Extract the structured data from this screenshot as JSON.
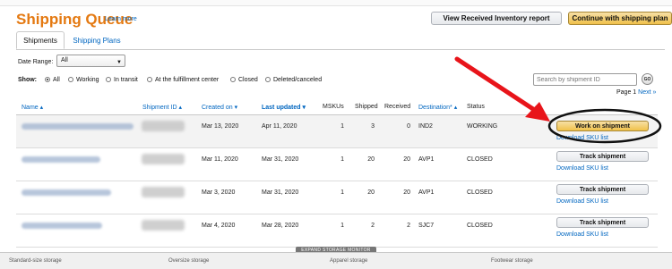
{
  "header": {
    "title": "Shipping Queue",
    "learn_more": "Learn more",
    "view_inventory_btn": "View Received Inventory report",
    "continue_btn": "Continue with shipping plan"
  },
  "tabs": [
    {
      "label": "Shipments",
      "active": true
    },
    {
      "label": "Shipping Plans",
      "active": false
    }
  ],
  "filters": {
    "date_range_label": "Date Range:",
    "date_range_value": "All",
    "show_label": "Show:",
    "options": [
      {
        "label": "All",
        "selected": true
      },
      {
        "label": "Working",
        "selected": false
      },
      {
        "label": "In transit",
        "selected": false
      },
      {
        "label": "At the fulfillment center",
        "selected": false
      },
      {
        "label": "Closed",
        "selected": false
      },
      {
        "label": "Deleted/canceled",
        "selected": false
      }
    ]
  },
  "search": {
    "placeholder": "Search by shipment ID",
    "go_label": "GO"
  },
  "pager": {
    "text": "Page 1",
    "next": "Next »"
  },
  "table": {
    "headers": {
      "name": "Name ▴",
      "shipment_id": "Shipment ID ▴",
      "created_on": "Created on ▾",
      "last_updated": "Last updated ▾",
      "mskus": "MSKUs",
      "shipped": "Shipped",
      "received": "Received",
      "destination": "Destination* ▴",
      "status": "Status"
    },
    "rows": [
      {
        "created": "Mar 13, 2020",
        "updated": "Apr 11, 2020",
        "mskus": "1",
        "shipped": "3",
        "received": "0",
        "destination": "IND2",
        "status": "WORKING",
        "action": "Work on shipment",
        "link": "Download SKU list"
      },
      {
        "created": "Mar 11, 2020",
        "updated": "Mar 31, 2020",
        "mskus": "1",
        "shipped": "20",
        "received": "20",
        "destination": "AVP1",
        "status": "CLOSED",
        "action": "Track shipment",
        "link": "Download SKU list"
      },
      {
        "created": "Mar 3, 2020",
        "updated": "Mar 31, 2020",
        "mskus": "1",
        "shipped": "20",
        "received": "20",
        "destination": "AVP1",
        "status": "CLOSED",
        "action": "Track shipment",
        "link": "Download SKU list"
      },
      {
        "created": "Mar 4, 2020",
        "updated": "Mar 28, 2020",
        "mskus": "1",
        "shipped": "2",
        "received": "2",
        "destination": "SJC7",
        "status": "CLOSED",
        "action": "Track shipment",
        "link": "Download SKU list"
      }
    ]
  },
  "bottom_bar": {
    "expand_label": "EXPAND STORAGE MONITOR",
    "segments": [
      "Standard-size storage",
      "Oversize storage",
      "Apparel storage",
      "Footwear storage"
    ]
  },
  "colors": {
    "title": "#e47911",
    "link": "#0066c0",
    "arrow": "#e8141a",
    "yellow_button": "#f0c14b"
  }
}
